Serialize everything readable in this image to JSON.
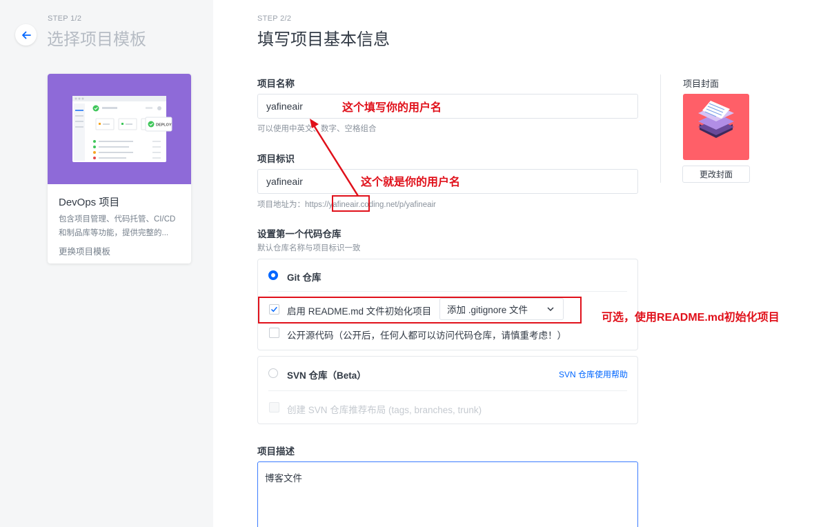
{
  "left": {
    "step": "STEP 1/2",
    "title": "选择项目模板",
    "template": {
      "name": "DevOps 项目",
      "description": "包含项目管理、代码托管、CI/CD和制品库等功能，提供完整的...",
      "change_link": "更换项目模板",
      "illustration_badge": "DEPLOY"
    }
  },
  "main": {
    "step": "STEP 2/2",
    "title": "填写项目基本信息",
    "project_name": {
      "label": "项目名称",
      "value": "yafineair",
      "hint": "可以使用中英文、数字、空格组合"
    },
    "project_id": {
      "label": "项目标识",
      "value": "yafineair",
      "hint_prefix": "项目地址为：",
      "hint_url": "https://yafineair.coding.net/p/yafineair"
    },
    "repo": {
      "label": "设置第一个代码仓库",
      "sublabel": "默认仓库名称与项目标识一致",
      "git": {
        "label": "Git 仓库",
        "selected": true,
        "readme_label": "启用 README.md 文件初始化项目",
        "readme_checked": true,
        "gitignore_select": "添加 .gitignore 文件",
        "public_label": "公开源代码（公开后，任何人都可以访问代码仓库，请慎重考虑！）",
        "public_checked": false
      },
      "svn": {
        "label": "SVN 仓库（Beta）",
        "help_link": "SVN 仓库使用帮助",
        "selected": false,
        "layout_label": "创建 SVN 仓库推荐布局 (tags, branches, trunk)"
      }
    },
    "description": {
      "label": "项目描述",
      "value": "博客文件"
    }
  },
  "cover": {
    "label": "项目封面",
    "change_button": "更改封面"
  },
  "annotations": {
    "name_note": "这个填写你的用户名",
    "id_note": "这个就是你的用户名",
    "readme_note": "可选，使用README.md初始化项目"
  },
  "colors": {
    "accent": "#0066ff",
    "annotation": "#e0101a",
    "template_banner": "#8e6ad8",
    "cover": "#ff5f68"
  }
}
